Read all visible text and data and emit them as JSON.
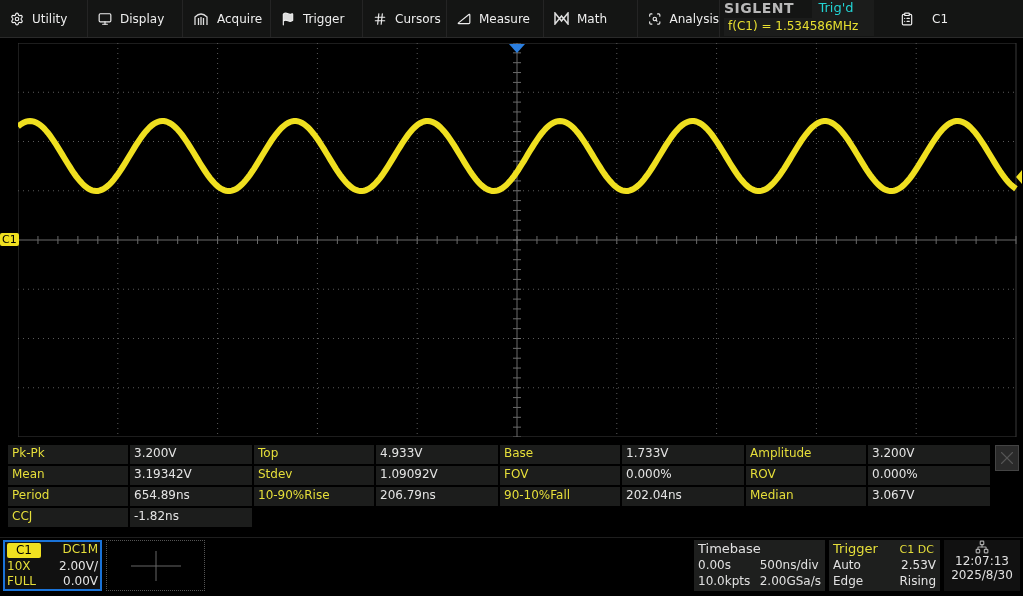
{
  "menu": [
    {
      "kind": "settings",
      "label": "Utility"
    },
    {
      "kind": "display",
      "label": "Display"
    },
    {
      "kind": "acquire",
      "label": "Acquire"
    },
    {
      "kind": "trigger",
      "label": "Trigger"
    },
    {
      "kind": "cursors",
      "label": "Cursors"
    },
    {
      "kind": "measure",
      "label": "Measure"
    },
    {
      "kind": "math",
      "label": "Math"
    },
    {
      "kind": "analysis",
      "label": "Analysis"
    }
  ],
  "status": {
    "brand": "SIGLENT",
    "trigger_state": "Trig'd",
    "frequency": "f(C1) = 1.534586MHz"
  },
  "channel_menu": {
    "label": "C1"
  },
  "graticule": {
    "channel_marker": "C1"
  },
  "measurements": [
    [
      {
        "label": "Pk-Pk",
        "value": "3.200V"
      },
      {
        "label": "Top",
        "value": "4.933V"
      },
      {
        "label": "Base",
        "value": "1.733V"
      },
      {
        "label": "Amplitude",
        "value": "3.200V"
      }
    ],
    [
      {
        "label": "Mean",
        "value": "3.19342V"
      },
      {
        "label": "Stdev",
        "value": "1.09092V"
      },
      {
        "label": "FOV",
        "value": "0.000%"
      },
      {
        "label": "ROV",
        "value": "0.000%"
      }
    ],
    [
      {
        "label": "Period",
        "value": "654.89ns"
      },
      {
        "label": "10-90%Rise",
        "value": "206.79ns"
      },
      {
        "label": "90-10%Fall",
        "value": "202.04ns"
      },
      {
        "label": "Median",
        "value": "3.067V"
      }
    ],
    [
      {
        "label": "CCJ",
        "value": "-1.82ns"
      }
    ]
  ],
  "channel_panel": {
    "name": "C1",
    "coupling": "DC1M",
    "probe": "10X",
    "scale": "2.00V/",
    "bandwidth": "FULL",
    "offset": "0.00V",
    "selected": true
  },
  "timebase": {
    "title": "Timebase",
    "delay": "0.00s",
    "scale": "500ns/div",
    "memory": "10.0kpts",
    "sample_rate": "2.00GSa/s"
  },
  "trigger": {
    "title": "Trigger",
    "source": "C1 DC",
    "mode": "Auto",
    "level": "2.53V",
    "type": "Edge",
    "slope": "Rising"
  },
  "clock": {
    "time": "12:07:13",
    "date": "2025/8/30"
  }
}
